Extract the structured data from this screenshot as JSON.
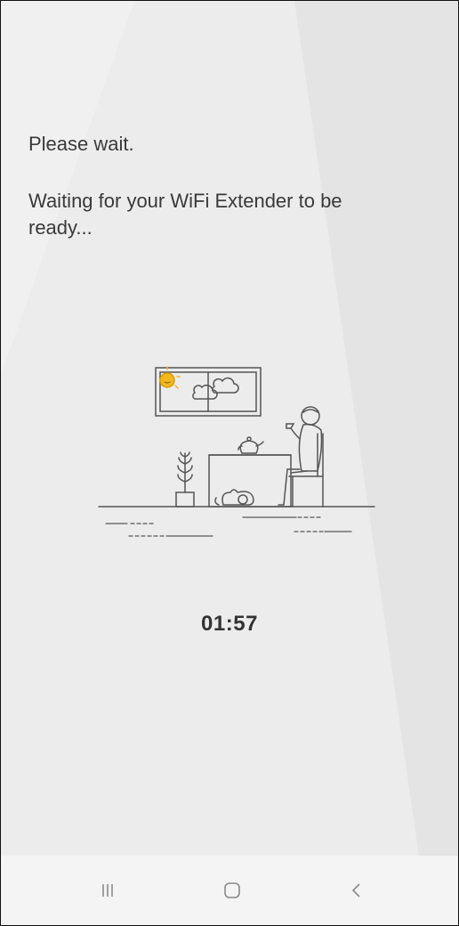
{
  "screen": {
    "title": "Please wait.",
    "message": "Waiting for your WiFi Extender to be ready...",
    "countdown": "01:57"
  },
  "illustration": {
    "name": "person-waiting-at-table-illustration",
    "accent_color": "#f2b71c"
  },
  "navbar": {
    "recent_apps": "recent-apps-icon",
    "home": "home-icon",
    "back": "back-icon"
  },
  "colors": {
    "background": "#ececec",
    "text": "#3a3a3a",
    "navbar": "#f4f4f4"
  }
}
